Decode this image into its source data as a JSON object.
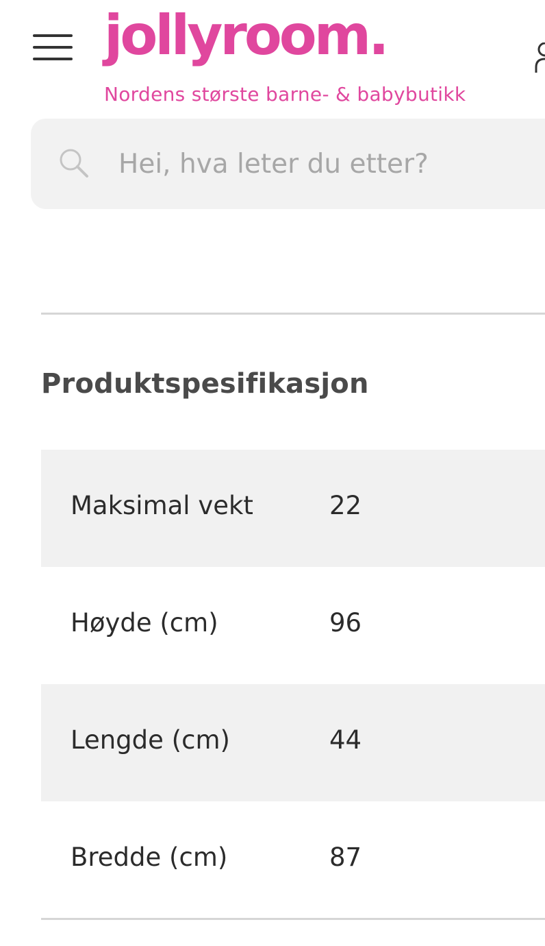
{
  "header": {
    "logo_text": "jollyroom.",
    "tagline": "Nordens største barne- & babybutikk",
    "brand_color": "#e0479e",
    "menu_icon": "hamburger-menu-icon",
    "account_icon": "user-icon"
  },
  "search": {
    "placeholder": "Hei, hva leter du etter?",
    "value": "",
    "icon": "search-icon"
  },
  "specs": {
    "title": "Produktspesifikasjon",
    "rows": [
      {
        "label": "Maksimal vekt",
        "value": "22"
      },
      {
        "label": "Høyde (cm)",
        "value": "96"
      },
      {
        "label": "Lengde (cm)",
        "value": "44"
      },
      {
        "label": "Bredde (cm)",
        "value": "87"
      }
    ]
  }
}
